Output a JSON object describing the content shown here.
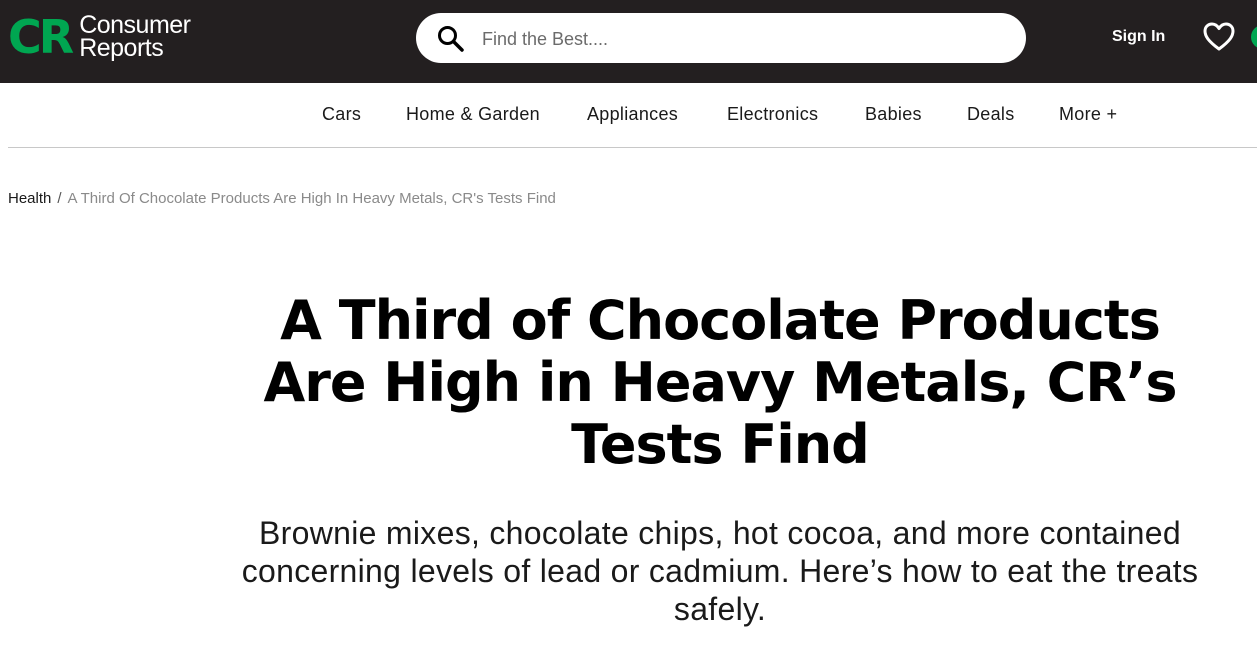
{
  "header": {
    "logo": {
      "mark": "CR",
      "line1": "Consumer",
      "line2": "Reports"
    },
    "search": {
      "placeholder": "Find the Best....",
      "value": "",
      "icon": "search-icon"
    },
    "sign_in_label": "Sign In",
    "favorites_icon": "heart-icon",
    "colors": {
      "background": "#231f20",
      "brand_green": "#00a651"
    }
  },
  "nav": {
    "items": [
      {
        "label": "Cars"
      },
      {
        "label": "Home & Garden"
      },
      {
        "label": "Appliances"
      },
      {
        "label": "Electronics"
      },
      {
        "label": "Babies"
      },
      {
        "label": "Deals"
      },
      {
        "label": "More +"
      }
    ]
  },
  "breadcrumb": {
    "parent": "Health",
    "separator": "/",
    "current": "A Third Of Chocolate Products Are High In Heavy Metals, CR's Tests Find"
  },
  "article": {
    "title": "A Third of Chocolate Products Are High in Heavy Metals, CR’s Tests Find",
    "subtitle": "Brownie mixes, chocolate chips, hot cocoa, and more contained concerning levels of lead or cadmium. Here’s how to eat the treats safely."
  }
}
